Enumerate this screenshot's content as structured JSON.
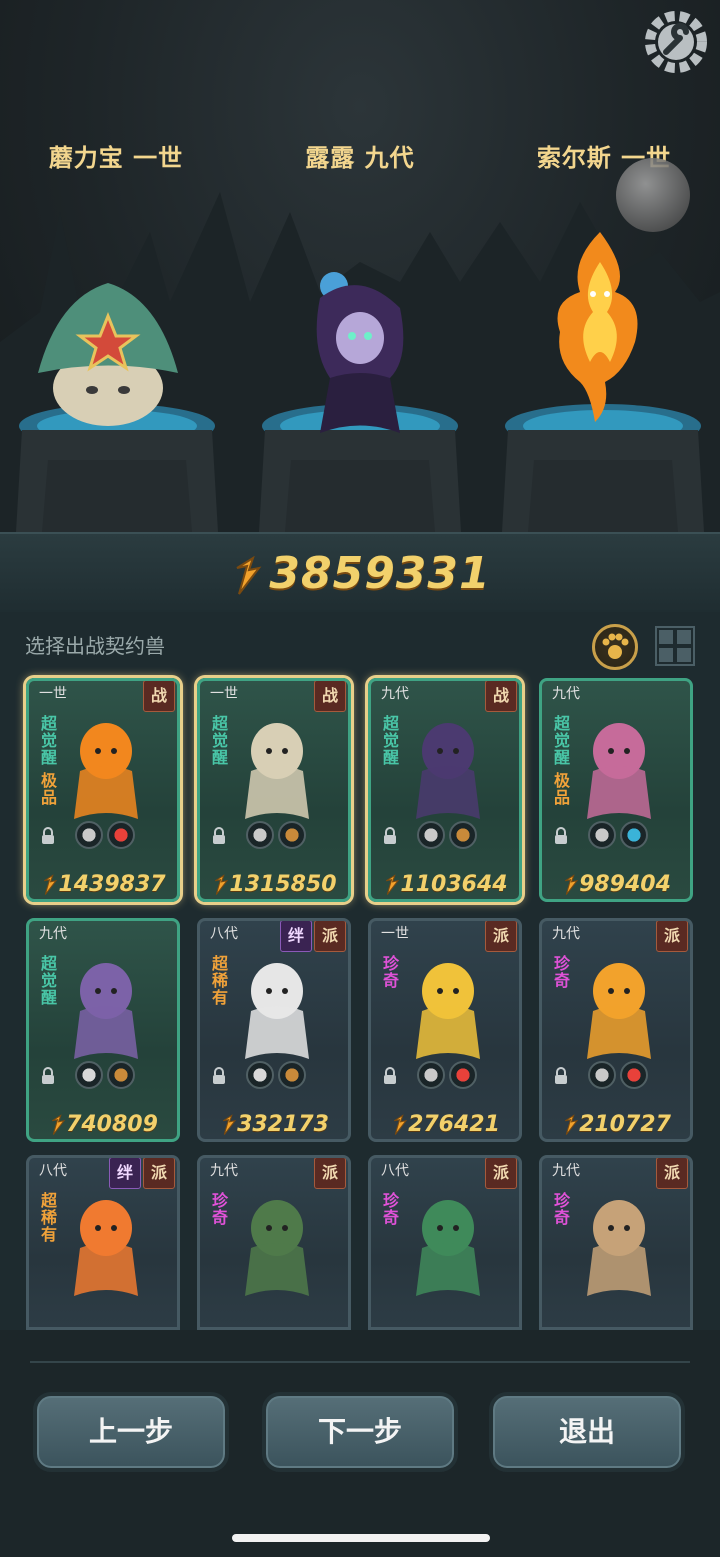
{
  "heroes": [
    {
      "name": "蘑力宝 一世"
    },
    {
      "name": "露露 九代"
    },
    {
      "name": "索尔斯 一世"
    }
  ],
  "power": {
    "value": "3859331"
  },
  "panel": {
    "label": "选择出战契约兽"
  },
  "cards": [
    {
      "gen": "一世",
      "badges": [
        "战"
      ],
      "tags": [
        {
          "text": "超觉醒",
          "cls": "c1"
        },
        {
          "text": "极品",
          "cls": "c2"
        }
      ],
      "score": "1439837",
      "selected": true,
      "theme": "green",
      "sprite": "fire-spirit",
      "icons": [
        "shield-icon",
        "fire-icon"
      ]
    },
    {
      "gen": "一世",
      "badges": [
        "战"
      ],
      "tags": [
        {
          "text": "超觉醒",
          "cls": "c1"
        }
      ],
      "score": "1315850",
      "selected": true,
      "theme": "green",
      "sprite": "mushroom",
      "icons": [
        "fist-icon",
        "earth-icon"
      ]
    },
    {
      "gen": "九代",
      "badges": [
        "战"
      ],
      "tags": [
        {
          "text": "超觉醒",
          "cls": "c1"
        }
      ],
      "score": "1103644",
      "selected": true,
      "theme": "green",
      "sprite": "rose-witch",
      "icons": [
        "shield-icon",
        "earth-icon"
      ]
    },
    {
      "gen": "九代",
      "badges": [],
      "tags": [
        {
          "text": "超觉醒",
          "cls": "c1"
        },
        {
          "text": "极品",
          "cls": "c2"
        }
      ],
      "score": "989404",
      "selected": false,
      "theme": "green",
      "sprite": "fox-mage",
      "icons": [
        "shield-icon",
        "water-icon"
      ]
    },
    {
      "gen": "九代",
      "badges": [],
      "tags": [
        {
          "text": "超觉醒",
          "cls": "c1"
        }
      ],
      "score": "740809",
      "selected": false,
      "theme": "green",
      "sprite": "dragon",
      "icons": [
        "eye-icon",
        "earth-icon"
      ]
    },
    {
      "gen": "八代",
      "badges": [
        "绊",
        "派"
      ],
      "tags": [
        {
          "text": "超稀有",
          "cls": "c2"
        }
      ],
      "score": "332173",
      "selected": false,
      "theme": "blue",
      "sprite": "white-sage",
      "icons": [
        "leaf-icon",
        "earth-icon"
      ]
    },
    {
      "gen": "一世",
      "badges": [
        "派"
      ],
      "tags": [
        {
          "text": "珍奇",
          "cls": "c3"
        }
      ],
      "score": "276421",
      "selected": false,
      "theme": "blue",
      "sprite": "gold-spirit",
      "icons": [
        "fist-icon",
        "fire-icon"
      ]
    },
    {
      "gen": "九代",
      "badges": [
        "派"
      ],
      "tags": [
        {
          "text": "珍奇",
          "cls": "c3"
        }
      ],
      "score": "210727",
      "selected": false,
      "theme": "blue",
      "sprite": "small-flame",
      "icons": [
        "shield-icon",
        "fire-icon"
      ]
    },
    {
      "gen": "八代",
      "badges": [
        "绊",
        "派"
      ],
      "tags": [
        {
          "text": "超稀有",
          "cls": "c2"
        }
      ],
      "score": "",
      "selected": false,
      "theme": "blue",
      "sprite": "phoenix",
      "icons": [
        "leaf-icon",
        "fire-icon"
      ]
    },
    {
      "gen": "九代",
      "badges": [
        "派"
      ],
      "tags": [
        {
          "text": "珍奇",
          "cls": "c3"
        }
      ],
      "score": "",
      "selected": false,
      "theme": "blue",
      "sprite": "treant",
      "icons": [
        "leaf-icon",
        "fire-icon"
      ]
    },
    {
      "gen": "八代",
      "badges": [
        "派"
      ],
      "tags": [
        {
          "text": "珍奇",
          "cls": "c3"
        }
      ],
      "score": "",
      "selected": false,
      "theme": "blue",
      "sprite": "vine-girl",
      "icons": [
        "shield-icon",
        "earth-icon"
      ]
    },
    {
      "gen": "九代",
      "badges": [
        "派"
      ],
      "tags": [
        {
          "text": "珍奇",
          "cls": "c3"
        }
      ],
      "score": "",
      "selected": false,
      "theme": "blue",
      "sprite": "serpent",
      "icons": [
        "eye-icon",
        "water-icon"
      ]
    }
  ],
  "buttons": {
    "prev": "上一步",
    "next": "下一步",
    "exit": "退出"
  },
  "colors": {
    "gold": "#f2d16c",
    "green_border": "#3fa383",
    "select_glow": "#e8cf8a"
  }
}
